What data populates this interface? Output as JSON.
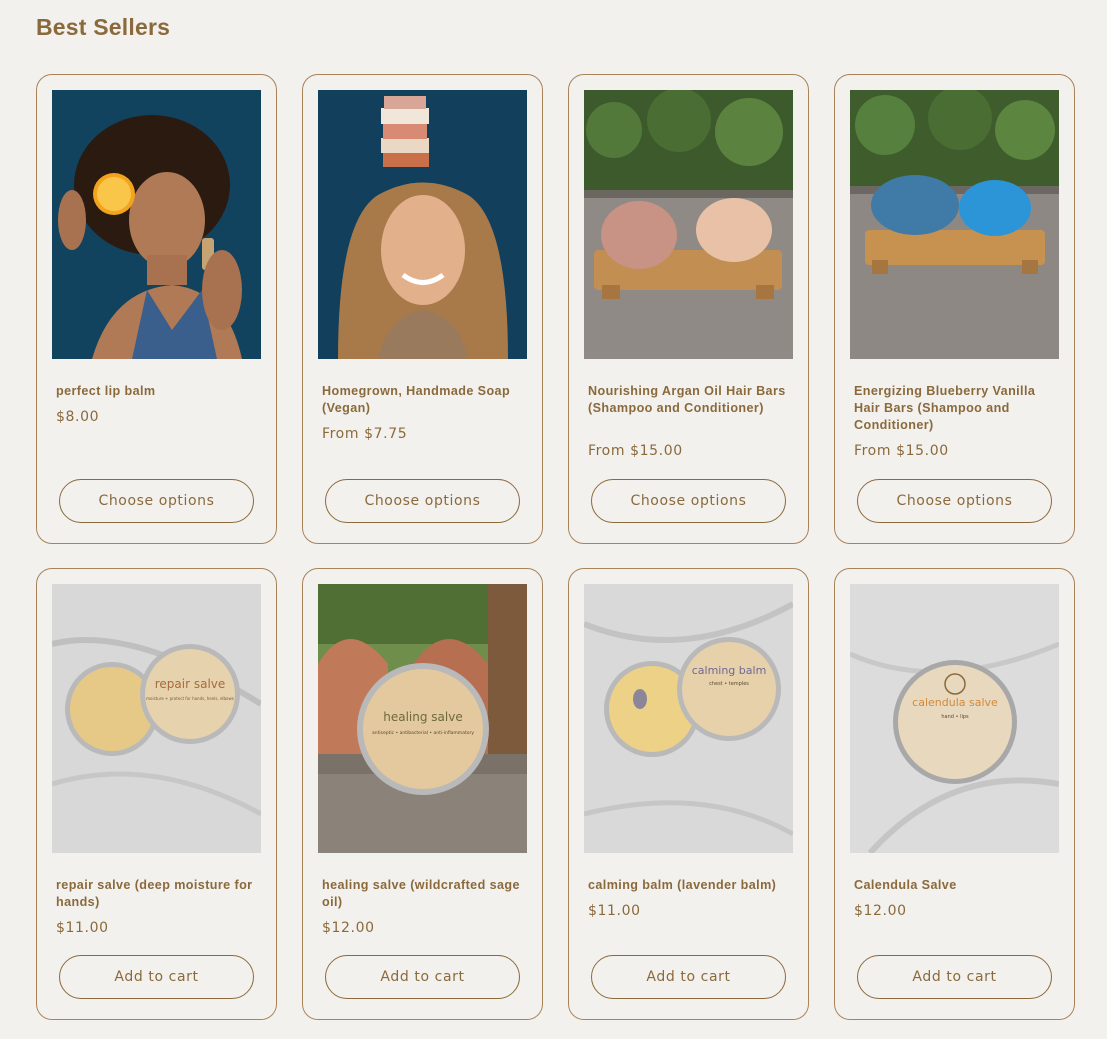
{
  "section": {
    "title": "Best Sellers"
  },
  "products": [
    {
      "title": "perfect lip balm",
      "price": "$8.00",
      "button": "Choose options",
      "image": "woman-holding-orange-and-lip-balm"
    },
    {
      "title": "Homegrown, Handmade Soap (Vegan)",
      "price": "From $7.75",
      "button": "Choose options",
      "image": "woman-with-soap-stack-on-head"
    },
    {
      "title": "Nourishing Argan Oil Hair Bars (Shampoo and Conditioner)",
      "price": "From $15.00",
      "button": "Choose options",
      "image": "argan-hair-bars-on-bamboo-dish"
    },
    {
      "title": "Energizing Blueberry Vanilla Hair Bars (Shampoo and Conditioner)",
      "price": "From $15.00",
      "button": "Choose options",
      "image": "blueberry-hair-bars-on-bamboo-dish"
    },
    {
      "title": "repair salve (deep moisture for hands)",
      "price": "$11.00",
      "button": "Add to cart",
      "image": "repair-salve-tin",
      "tin": {
        "brand": "repair salve",
        "sub": "moisture + protect for hands, heels, elbows"
      }
    },
    {
      "title": "healing salve (wildcrafted sage oil)",
      "price": "$12.00",
      "button": "Add to cart",
      "image": "healing-salve-tin",
      "tin": {
        "brand": "healing salve",
        "sub": "antiseptic • antibacterial • anti-inflammatory"
      }
    },
    {
      "title": "calming balm (lavender balm)",
      "price": "$11.00",
      "button": "Add to cart",
      "image": "calming-balm-tin",
      "tin": {
        "brand": "calming balm",
        "sub": "chest • temples"
      }
    },
    {
      "title": "Calendula Salve",
      "price": "$12.00",
      "button": "Add to cart",
      "image": "calendula-salve-tin",
      "tin": {
        "brand": "calendula salve",
        "sub": "hand • lips"
      }
    }
  ]
}
